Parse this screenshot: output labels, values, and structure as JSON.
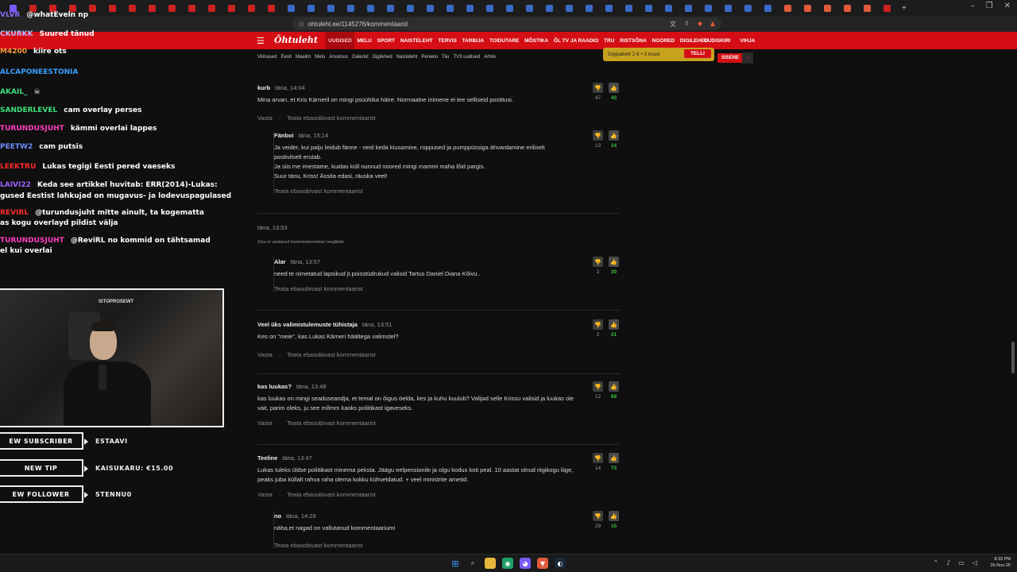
{
  "browser": {
    "url": "ohtuleht.ee/1145276/kommentaarid",
    "tab_colors": [
      "#7a5af8",
      "#cc2222",
      "#cc2222",
      "#cc2222",
      "#cc2222",
      "#cc2222",
      "#cc2222",
      "#cc2222",
      "#cc2222",
      "#cc2222",
      "#cc2222",
      "#cc2222",
      "#cc2222",
      "#cc2222",
      "#3a6ac8",
      "#3a6ac8",
      "#3a6ac8",
      "#3a6ac8",
      "#3a6ac8",
      "#3a6ac8",
      "#3a6ac8",
      "#3a6ac8",
      "#3a6ac8",
      "#3a6ac8",
      "#3a6ac8",
      "#3a6ac8",
      "#3a6ac8",
      "#3a6ac8",
      "#3a6ac8",
      "#3a6ac8",
      "#3a6ac8",
      "#3a6ac8",
      "#3a6ac8",
      "#3a6ac8",
      "#3a6ac8",
      "#3a6ac8",
      "#3a6ac8",
      "#3a6ac8",
      "#3a6ac8",
      "#e05a3a",
      "#e05a3a",
      "#e05a3a",
      "#e05a3a",
      "#e05a3a",
      "#cc2222"
    ],
    "new_tab": "+",
    "win_min": "–",
    "win_max": "❐",
    "win_close": "✕"
  },
  "site": {
    "logo": "Õhtuleht",
    "nav": [
      "UUDISED",
      "MELU",
      "SPORT",
      "NAISTELEHT",
      "TERVIS",
      "TARBIJA",
      "TOIDUTARE",
      "MÕSTIKA",
      "ÕL TV JA RAADIO",
      "TRU",
      "RISTSÕNA",
      "NOORED",
      "DIGILEHED"
    ],
    "nav_right": [
      "UUDISKIRI",
      "VIHJA"
    ],
    "subnav": [
      "Viimased",
      "Eesti",
      "Maailm",
      "Melu",
      "Arvamus",
      "Galeriid",
      "Digilehed",
      "Naisteleht",
      "Pereelu",
      "Tiiu",
      "TV3 uudised",
      "Arhiiv"
    ],
    "promo_text": "Digipakett 2 € • 2 kuud",
    "promo_btn": "TELLI",
    "login": "SISENE"
  },
  "comments": [
    {
      "author": "kurb",
      "time": "täna, 14:04",
      "text": "Mina arvan, et Kris Kärneril on mingi psüühika häire. Normaalne inimene ei tee selliseid postitusi.",
      "down": "47",
      "up": "43",
      "reply_link": "Vasta",
      "report": "Teata ebasobivast kommentaarist"
    },
    {
      "author": "Fänboi",
      "time": "täna, 15:14",
      "text": "Ja veider, kui palju leidub fänne - neid keda kiusamine, roppused ja pumppüssiga ähvardamine eriliselt postiviiselt erutab.\nJa siis me imestame, kuidas küll nunnud noored mingi mammi maha lõid pargis.\nSuur tänu, Kriss! Ässita edasi, räuska veel!",
      "down": "13",
      "up": "14",
      "report": "Teata ebasobivast kommentaarist"
    },
    {
      "author": "",
      "time": "täna, 13:53",
      "note": "Sisu ei vastanud kommenteerimise reeglitele"
    },
    {
      "author": "Alar",
      "time": "täna, 13:57",
      "text": "need te nimetatud lapsikud jt.poisstüdrukud valisid Tartus Daniel Diana Kõivu..",
      "down": "2",
      "up": "30",
      "report": "Teata ebasobivast kommentaarist"
    },
    {
      "author": "Veel üks valimistulemuste tühistaja",
      "time": "täna, 13:51",
      "text": "Kes on \"meie\", kas Lukas Kärneri häältega valimstel?",
      "down": "2",
      "up": "31",
      "reply_link": "Vasta",
      "report": "Teata ebasobivast kommentaarist"
    },
    {
      "author": "kas luukas?",
      "time": "täna, 13:48",
      "text": "kas luukas on mingi seaduseandja, et temal on õigus öelda, kes ja kuhu kuulub? Valijad selle Krissu valisid ja luukas ole vait, parim oleks, ju see mõmm kaoks poliitikast igaveseks.",
      "down": "12",
      "up": "69",
      "reply_link": "Vasta",
      "report": "Teata ebasobivast kommentaarist"
    },
    {
      "author": "Teeline",
      "time": "täna, 13:47",
      "text": "Lukas tuleks üldse poliitikast minema peksta. Jäägu eelpensionile ja olgu kodus koti peal. 10 aastat olnud riigikogu liige, peaks juba küllalt rahva raha olema kokku kühveldatud. + veel ministrite ametid.",
      "down": "14",
      "up": "73",
      "reply_link": "Vasta",
      "report": "Teata ebasobivast kommentaarist"
    },
    {
      "author": "no",
      "time": "täna, 14:29",
      "text": "näha,et nagad on vallutanud kommentaariumi",
      "down": "29",
      "up": "15",
      "report": "Teata ebasobivast kommentaarist"
    }
  ],
  "chat": [
    {
      "name": "VLVR",
      "color": "#8a6cff",
      "msg": "@whatEveln np"
    },
    {
      "name": "CKURKK",
      "color": "#b9b9ff",
      "msg": "Suured tänud"
    },
    {
      "name": "M4200",
      "color": "#ff9a3c",
      "msg": "kiire ots"
    },
    {
      "name": "ALCAPONEESTONIA",
      "color": "#3aa0ff",
      "msg": ""
    },
    {
      "name": "AKAIL_",
      "color": "#3ee07a",
      "msg": "☠"
    },
    {
      "name": "SANDERLEVEL",
      "color": "#3ee07a",
      "msg": "cam overlay perses"
    },
    {
      "name": "TURUNDUSJUHT",
      "color": "#ff3ec0",
      "msg": "kämmi overlai lappes"
    },
    {
      "name": "PEETW2",
      "color": "#6c8cff",
      "msg": "cam putsis"
    },
    {
      "name": "LEEKTRU",
      "color": "#ff2a2a",
      "msg": "Lukas tegigi Eesti pered vaeseks"
    },
    {
      "name": "LAIVI22",
      "color": "#a060ff",
      "msg": "Keda see artikkel huvitab: ERR(2014)-Lukas:"
    },
    {
      "name": "",
      "color": "#fff",
      "msg": "gused Eestist lahkujad on mugavus- ja lodevuspagulased"
    },
    {
      "name": "REVIRL",
      "color": "#ff2a2a",
      "msg": "@turundusjuht mitte ainult, ta kogematta"
    },
    {
      "name": "",
      "color": "#fff",
      "msg": "as kogu overlayd pildist välja"
    },
    {
      "name": "TURUNDUSJUHT",
      "color": "#ff3ec0",
      "msg": "@ReviRL no kommid on tähtsamad"
    },
    {
      "name": "",
      "color": "#fff",
      "msg": "el kui overlai"
    }
  ],
  "webcam": {
    "logo": "ISTOPROSEWT"
  },
  "alerts": [
    {
      "label": "EW SUBSCRIBER",
      "value": "ESTAAVI"
    },
    {
      "label": "NEW TIP",
      "value": "KAISUKARU: €15.00"
    },
    {
      "label": "EW FOLLOWER",
      "value": "STENNU0"
    }
  ],
  "taskbar": {
    "time": "8:33 PM",
    "date": "26-Nov-25"
  }
}
